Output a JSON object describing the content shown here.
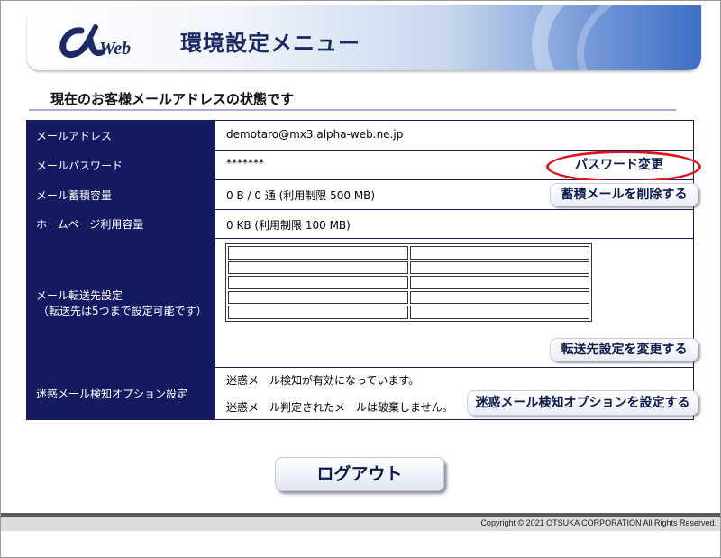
{
  "header": {
    "logo_text": "αWeb",
    "title": "環境設定メニュー"
  },
  "section": {
    "title": "現在のお客様メールアドレスの状態です"
  },
  "rows": {
    "email": {
      "label": "メールアドレス",
      "value": "demotaro@mx3.alpha-web.ne.jp"
    },
    "password": {
      "label": "メールパスワード",
      "value": "*******",
      "button": "パスワード変更"
    },
    "storage": {
      "label": "メール蓄積容量",
      "value": "0 B / 0 通 (利用制限 500 MB)",
      "button": "蓄積メールを削除する"
    },
    "homepage": {
      "label": "ホームページ利用容量",
      "value": "0 KB (利用制限 100 MB)"
    },
    "forward": {
      "label_line1": "メール転送先設定",
      "label_line2": "（転送先は5つまで設定可能です）",
      "button": "転送先設定を変更する"
    },
    "spam": {
      "label": "迷惑メール検知オプション設定",
      "status_line1": "迷惑メール検知が有効になっています。",
      "status_line2": "迷惑メール判定されたメールは破棄しません。",
      "button": "迷惑メール検知オプションを設定する"
    }
  },
  "logout_label": "ログアウト",
  "footer": {
    "copyright": "Copyright © 2021 OTSUKA CORPORATION All Rights Reserved."
  },
  "colors": {
    "label_bg": "#141a62",
    "highlight": "#e0141e",
    "banner_accent": "#3f6fc6"
  }
}
